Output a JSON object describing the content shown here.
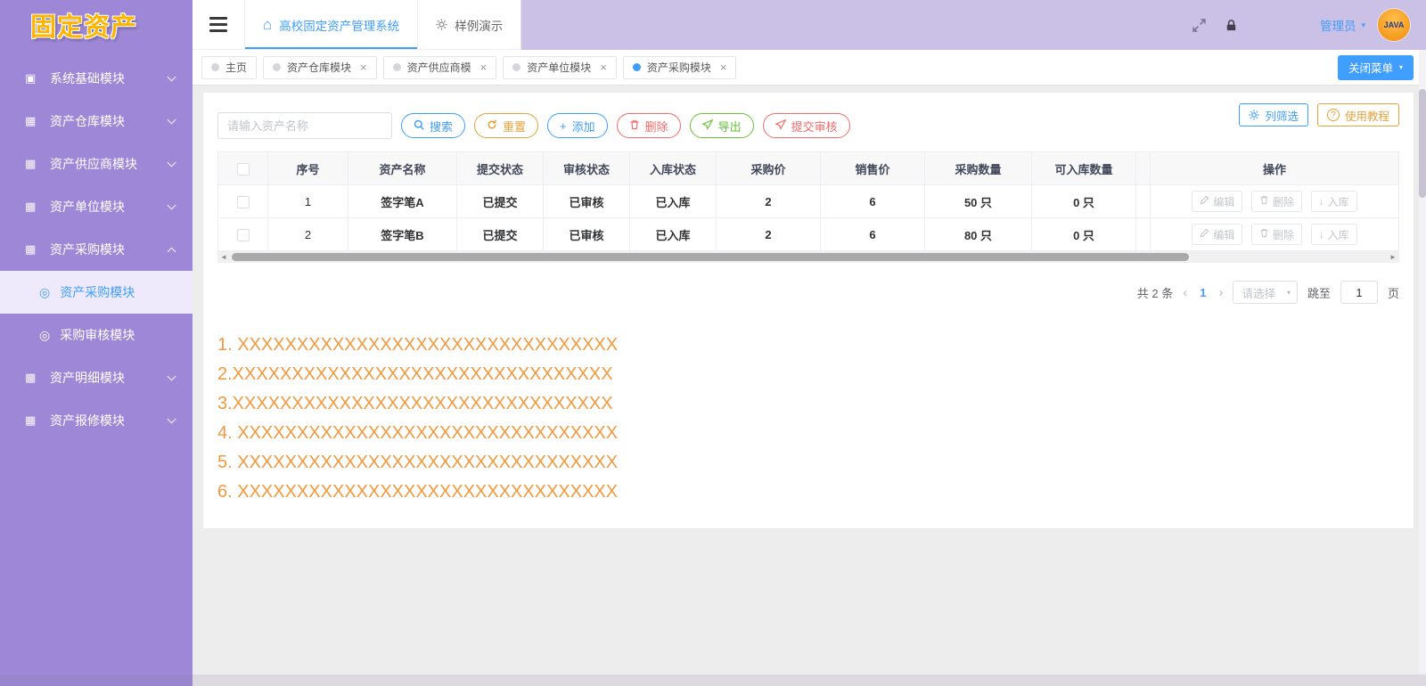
{
  "colors": {
    "primary": "#409eff",
    "warning": "#e6a23c",
    "danger": "#f56c6c",
    "success": "#67c23a",
    "sidebar_purple": "#9e87d7",
    "note_orange": "#f2993e"
  },
  "icons": {
    "grid": "▦",
    "check_grid": "▣",
    "target": "◎",
    "home": "⌂",
    "close": "×",
    "caret_down": "▾",
    "plus": "+",
    "question": "?",
    "arrow_down": "↓",
    "scroll_left": "◄",
    "scroll_right": "►",
    "pager_prev": "‹",
    "pager_next": "›"
  },
  "sidebar": {
    "logo": "固定资产",
    "items": [
      {
        "label": "系统基础模块"
      },
      {
        "label": "资产仓库模块"
      },
      {
        "label": "资产供应商模块"
      },
      {
        "label": "资产单位模块"
      },
      {
        "label": "资产采购模块"
      },
      {
        "label": "资产明细模块"
      },
      {
        "label": "资产报修模块"
      }
    ],
    "submenu": [
      {
        "label": "资产采购模块"
      },
      {
        "label": "采购审核模块"
      }
    ]
  },
  "header": {
    "tabs": [
      {
        "label": "高校固定资产管理系统"
      },
      {
        "label": "样例演示"
      }
    ],
    "username": "管理员",
    "avatar_text": "JAVA"
  },
  "tagbar": {
    "tags": [
      {
        "label": "主页"
      },
      {
        "label": "资产仓库模块"
      },
      {
        "label": "资产供应商模"
      },
      {
        "label": "资产单位模块"
      },
      {
        "label": "资产采购模块"
      }
    ],
    "close_menu": "关闭菜单"
  },
  "panel": {
    "column_filter": "列筛选",
    "tutorial": "使用教程",
    "search_placeholder": "请输入资产名称",
    "actions": {
      "search": "搜索",
      "reset": "重置",
      "add": "添加",
      "delete": "删除",
      "export": "导出",
      "submit_review": "提交审核"
    }
  },
  "table": {
    "columns": [
      "序号",
      "资产名称",
      "提交状态",
      "审核状态",
      "入库状态",
      "采购价",
      "销售价",
      "采购数量",
      "可入库数量",
      "操作"
    ],
    "rows": [
      {
        "seq": "1",
        "name": "签字笔A",
        "submit": "已提交",
        "review": "已审核",
        "stock": "已入库",
        "purchase_price": "2",
        "sale_price": "6",
        "purchase_qty": "50 只",
        "stockable_qty": "0 只"
      },
      {
        "seq": "2",
        "name": "签字笔B",
        "submit": "已提交",
        "review": "已审核",
        "stock": "已入库",
        "purchase_price": "2",
        "sale_price": "6",
        "purchase_qty": "80 只",
        "stockable_qty": "0 只"
      }
    ],
    "row_actions": {
      "edit": "编辑",
      "delete": "删除",
      "stock_in": "入库"
    }
  },
  "pagination": {
    "total": "共 2 条",
    "current_page": "1",
    "page_size_placeholder": "请选择",
    "jump_label": "跳至",
    "jump_value": "1",
    "page_suffix": "页"
  },
  "notes": [
    "1. XXXXXXXXXXXXXXXXXXXXXXXXXXXXXXXX",
    "2.XXXXXXXXXXXXXXXXXXXXXXXXXXXXXXXX",
    "3.XXXXXXXXXXXXXXXXXXXXXXXXXXXXXXXX",
    "4. XXXXXXXXXXXXXXXXXXXXXXXXXXXXXXXX",
    "5. XXXXXXXXXXXXXXXXXXXXXXXXXXXXXXXX",
    "6. XXXXXXXXXXXXXXXXXXXXXXXXXXXXXXXX"
  ]
}
